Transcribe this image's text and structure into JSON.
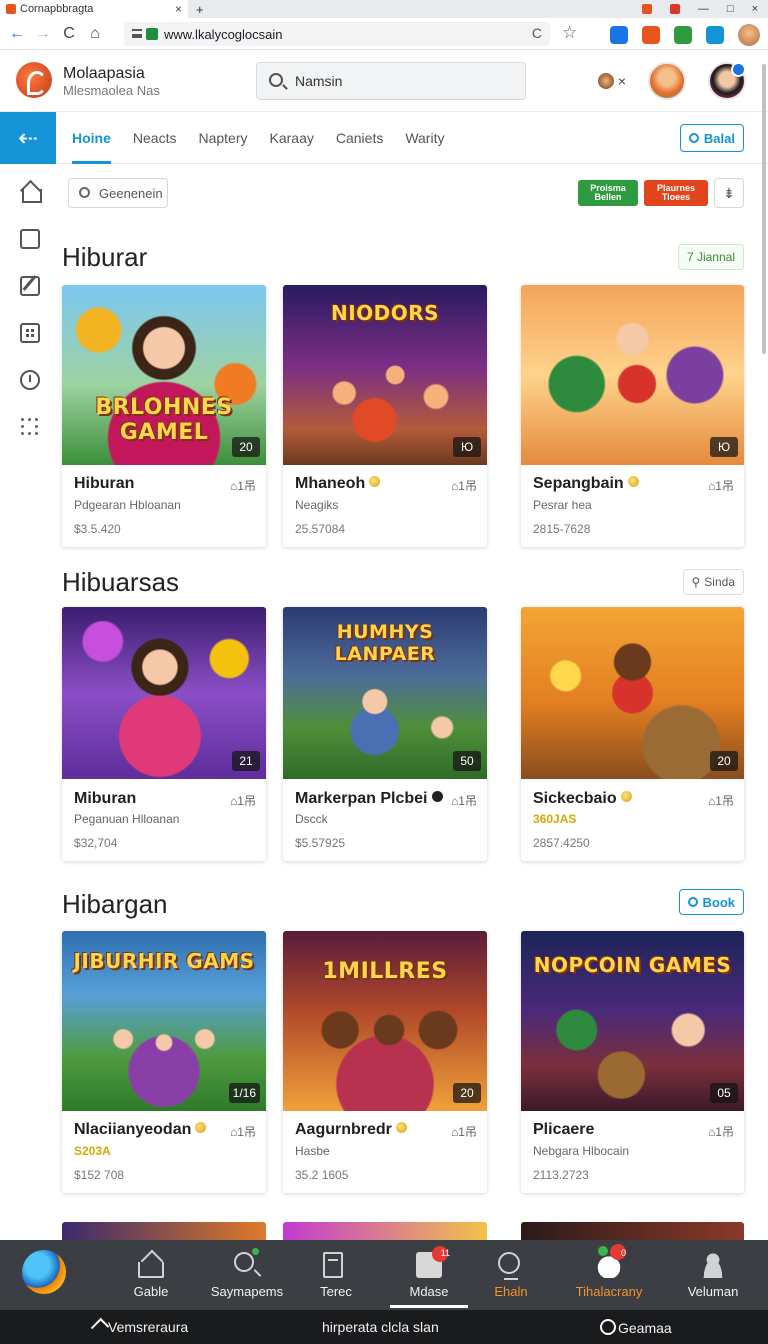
{
  "browser": {
    "tab_title": "Cornapbbragta",
    "tab_close": "×",
    "new_tab": "+",
    "url": "www.lkalycoglocsain",
    "reload": "C",
    "back": "←",
    "forward": "→",
    "refresh": "C",
    "home": "⌂",
    "bookmark": "☆",
    "window_controls": [
      "—",
      "□",
      "×"
    ]
  },
  "header": {
    "brand_name": "Molaapasia",
    "brand_sub": "Mlesmaolea Nas",
    "search_placeholder": "Namsin",
    "mini_close": "×"
  },
  "tabbar": {
    "back_glyph": "⇠",
    "tabs": [
      {
        "label": "Hoine",
        "active": true
      },
      {
        "label": "Neacts"
      },
      {
        "label": "Naptery"
      },
      {
        "label": "Karaay"
      },
      {
        "label": "Caniets"
      },
      {
        "label": "Warity"
      }
    ],
    "right_button": "Balal"
  },
  "filter": {
    "search_placeholder": "Geenenein",
    "badge_green": "Proisma Bellen",
    "badge_red": "Plaurnes Tioees",
    "square_button": "⇟"
  },
  "sections": [
    {
      "title": "Hiburar",
      "pill": "7 Jiannal",
      "cards": [
        {
          "thumb_text": "BRLOHNES GAMEL",
          "count": "20",
          "title": "Hiburan",
          "coin": false,
          "stat": "⌂1吊",
          "sub": "Pdgearan Hbloanan",
          "sub_gold": false,
          "price": "$3.5.420"
        },
        {
          "thumb_text": "NIODORS",
          "count": "Ю",
          "title": "Mhaneoh",
          "coin": true,
          "stat": "⌂1吊",
          "sub": "Neagiks",
          "sub_gold": false,
          "price": "25.57084"
        },
        {
          "thumb_text": "",
          "count": "Ю",
          "title": "Sepangbain",
          "coin": true,
          "stat": "⌂1吊",
          "sub": "Pesrar hea",
          "sub_gold": false,
          "price": "2815-7628"
        }
      ]
    },
    {
      "title": "Hibuarsas",
      "pill": "Sinda",
      "cards": [
        {
          "thumb_text": "",
          "count": "21",
          "title": "Miburan",
          "coin": false,
          "stat": "⌂1吊",
          "sub": "Peganuan Hlloanan",
          "sub_gold": false,
          "price": "$32,704"
        },
        {
          "thumb_text": "HUMHYS LANPAER",
          "count": "50",
          "title": "Markerpan Plcbei",
          "coin": true,
          "coin_dark": true,
          "stat": "⌂1吊",
          "sub": "Dscck",
          "sub_gold": false,
          "price": "$5.57925"
        },
        {
          "thumb_text": "",
          "count": "20",
          "title": "Sickecbaio",
          "coin": true,
          "stat": "⌂1吊",
          "sub": "360JAS",
          "sub_gold": true,
          "price": "2857.4250"
        }
      ]
    },
    {
      "title": "Hibargan",
      "pill": "Book",
      "cards": [
        {
          "thumb_text": "JIBURHIR GAMS",
          "count": "1/16",
          "title": "Nlaciianyeodan",
          "coin": true,
          "stat": "⌂1吊",
          "sub": "S203A",
          "sub_gold": true,
          "price": "$152 708"
        },
        {
          "thumb_text": "1MILLRES",
          "count": "20",
          "title": "Aagurnbredr",
          "coin": true,
          "stat": "⌂1吊",
          "sub": "Hasbe",
          "sub_gold": false,
          "price": "35.2 1605"
        },
        {
          "thumb_text": "NOPCOIN GAMES",
          "count": "05",
          "title": "Plicaere",
          "coin": false,
          "stat": "⌂1吊",
          "sub": "Nebgara Hlbocain",
          "sub_gold": false,
          "price": "2113.2723"
        }
      ]
    }
  ],
  "bottom_nav": {
    "items": [
      {
        "label": "Gable",
        "icon": "house-icon"
      },
      {
        "label": "Saymapems",
        "icon": "search-icon"
      },
      {
        "label": "Terec",
        "icon": "document-icon"
      },
      {
        "label": "Mdase",
        "icon": "ticket-icon",
        "active": true,
        "badge": "11"
      },
      {
        "label": "Ehaln",
        "icon": "search-person-icon",
        "orange": true
      },
      {
        "label": "Tihalacrany",
        "icon": "cloud-icon",
        "orange": true,
        "badge": "0"
      },
      {
        "label": "Veluman",
        "icon": "user-icon"
      }
    ]
  },
  "system_bar": {
    "left": "Vemsreraura",
    "center": "hirperata clcla slan",
    "right": "Geamaa"
  },
  "colors": {
    "accent": "#1493d6",
    "nav_bg": "#3b3f44",
    "orange": "#f5922d"
  }
}
